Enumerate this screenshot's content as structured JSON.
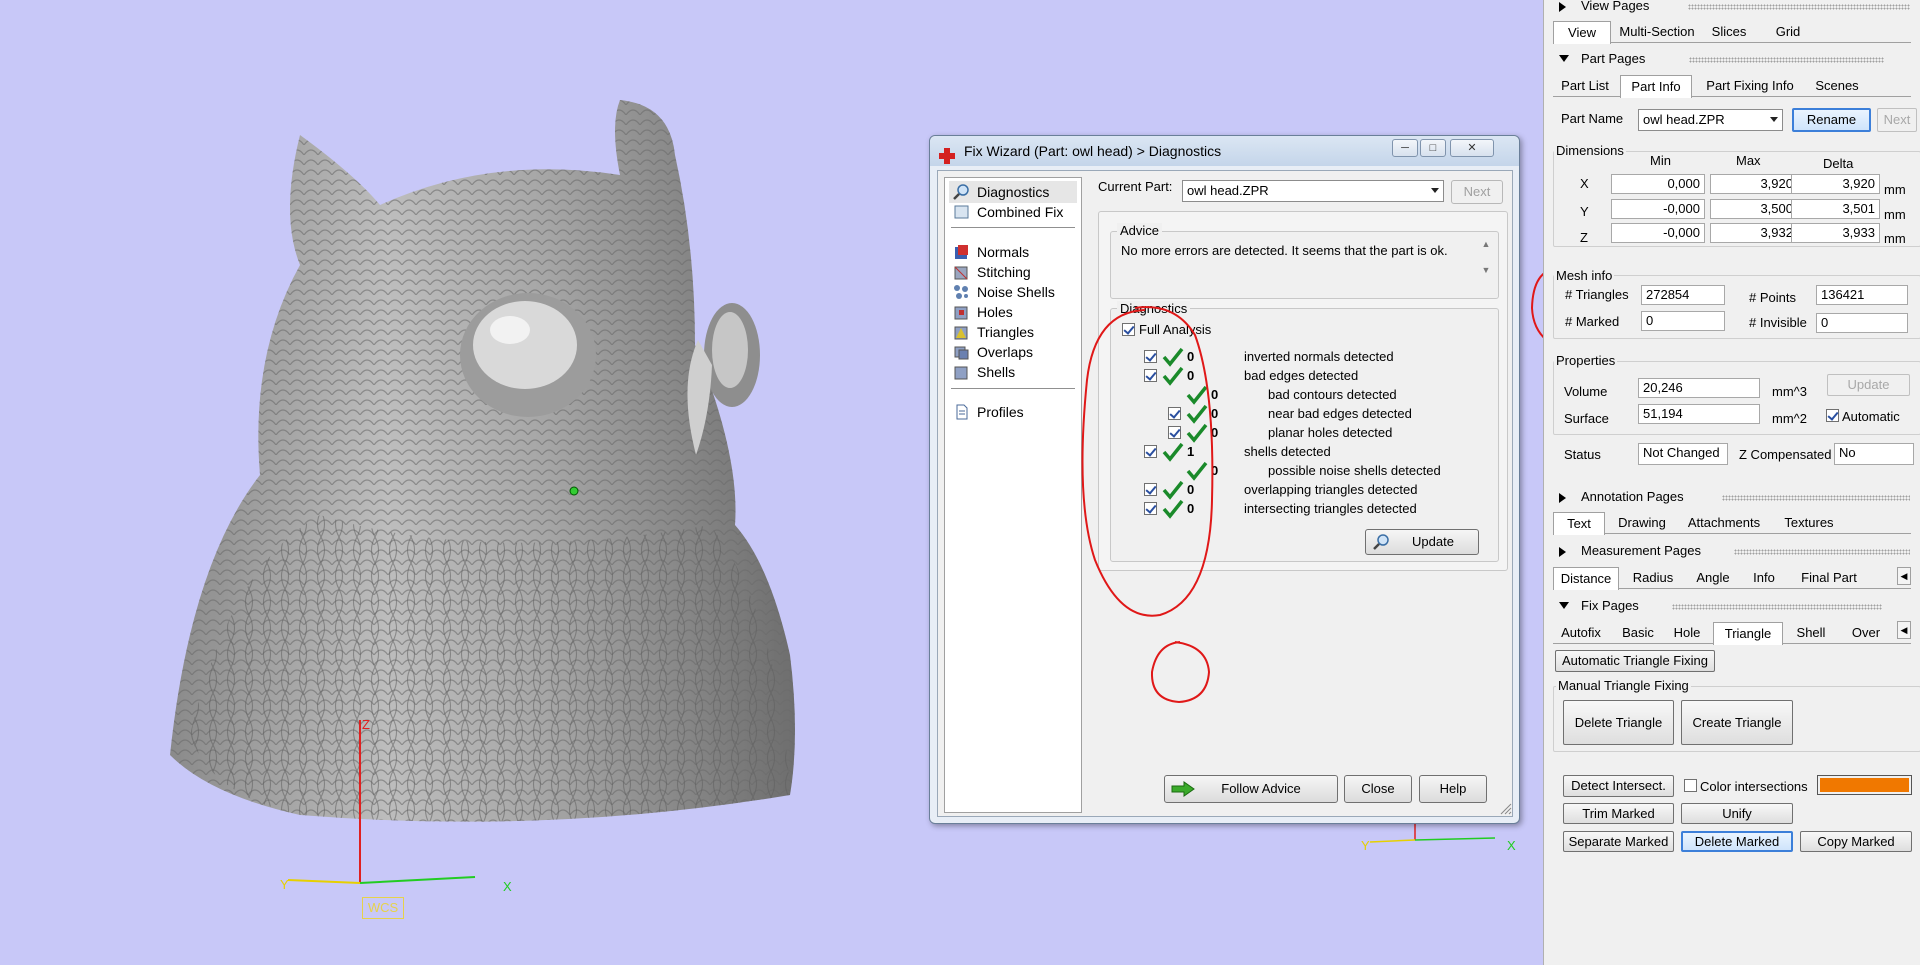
{
  "viewport": {
    "wcs_label": "WCS",
    "axis_x": "X",
    "axis_y": "Y",
    "axis_z": "Z",
    "mini_axis_x": "X",
    "mini_axis_y": "Y"
  },
  "dialog": {
    "title": "Fix Wizard (Part: owl head) > Diagnostics",
    "nav_items": [
      "Diagnostics",
      "Combined Fix",
      "Normals",
      "Stitching",
      "Noise Shells",
      "Holes",
      "Triangles",
      "Overlaps",
      "Shells",
      "Profiles"
    ],
    "current_part_label": "Current Part:",
    "current_part_value": "owl head.ZPR",
    "next_label": "Next",
    "advice_title": "Advice",
    "advice_text": "No more errors are detected. It seems that the part is ok.",
    "diagnostics_title": "Diagnostics",
    "full_analysis_label": "Full Analysis",
    "rows": [
      {
        "count": "0",
        "text": "inverted normals detected"
      },
      {
        "count": "0",
        "text": "bad edges detected"
      },
      {
        "count": "0",
        "text": "bad contours detected"
      },
      {
        "count": "0",
        "text": "near bad edges detected"
      },
      {
        "count": "0",
        "text": "planar holes detected"
      },
      {
        "count": "1",
        "text": "shells detected"
      },
      {
        "count": "0",
        "text": "possible noise shells detected"
      },
      {
        "count": "0",
        "text": "overlapping triangles detected"
      },
      {
        "count": "0",
        "text": "intersecting triangles detected"
      }
    ],
    "update_label": "Update",
    "follow_advice_label": "Follow Advice",
    "close_label": "Close",
    "help_label": "Help"
  },
  "panel": {
    "view_pages": "View Pages",
    "view_tabs": [
      "View",
      "Multi-Section",
      "Slices",
      "Grid"
    ],
    "part_pages": "Part Pages",
    "part_tabs": [
      "Part List",
      "Part Info",
      "Part Fixing Info",
      "Scenes"
    ],
    "part_name_label": "Part Name",
    "part_name_value": "owl head.ZPR",
    "rename_label": "Rename",
    "next_label": "Next",
    "dimensions_title": "Dimensions",
    "dim_headers": [
      "Min",
      "Max",
      "Delta"
    ],
    "dim_rows": [
      {
        "axis": "X",
        "min": "0,000",
        "max": "3,920",
        "delta": "3,920",
        "unit": "mm"
      },
      {
        "axis": "Y",
        "min": "-0,000",
        "max": "3,500",
        "delta": "3,501",
        "unit": "mm"
      },
      {
        "axis": "Z",
        "min": "-0,000",
        "max": "3,932",
        "delta": "3,933",
        "unit": "mm"
      }
    ],
    "mesh_info_title": "Mesh info",
    "triangles_label": "# Triangles",
    "triangles_value": "272854",
    "points_label": "# Points",
    "points_value": "136421",
    "marked_label": "# Marked",
    "marked_value": "0",
    "invisible_label": "# Invisible",
    "invisible_value": "0",
    "properties_title": "Properties",
    "volume_label": "Volume",
    "volume_value": "20,246",
    "volume_unit": "mm^3",
    "surface_label": "Surface",
    "surface_value": "51,194",
    "surface_unit": "mm^2",
    "update_label": "Update",
    "automatic_label": "Automatic",
    "status_label": "Status",
    "status_value": "Not Changed",
    "zcomp_label": "Z Compensated",
    "zcomp_value": "No",
    "annotation_pages": "Annotation Pages",
    "annotation_tabs": [
      "Text",
      "Drawing",
      "Attachments",
      "Textures"
    ],
    "measurement_pages": "Measurement Pages",
    "measurement_tabs": [
      "Distance",
      "Radius",
      "Angle",
      "Info",
      "Final Part"
    ],
    "fix_pages": "Fix Pages",
    "fix_tabs": [
      "Autofix",
      "Basic",
      "Hole",
      "Triangle",
      "Shell",
      "Over"
    ],
    "auto_triangle_fixing": "Automatic Triangle Fixing",
    "manual_triangle_fixing": "Manual Triangle Fixing",
    "delete_triangle": "Delete Triangle",
    "create_triangle": "Create Triangle",
    "detect_intersect": "Detect Intersect.",
    "color_intersections": "Color intersections",
    "trim_marked": "Trim Marked",
    "unify": "Unify",
    "separate_marked": "Separate Marked",
    "delete_marked": "Delete Marked",
    "copy_marked": "Copy Marked",
    "intersection_color": "#f07800"
  }
}
